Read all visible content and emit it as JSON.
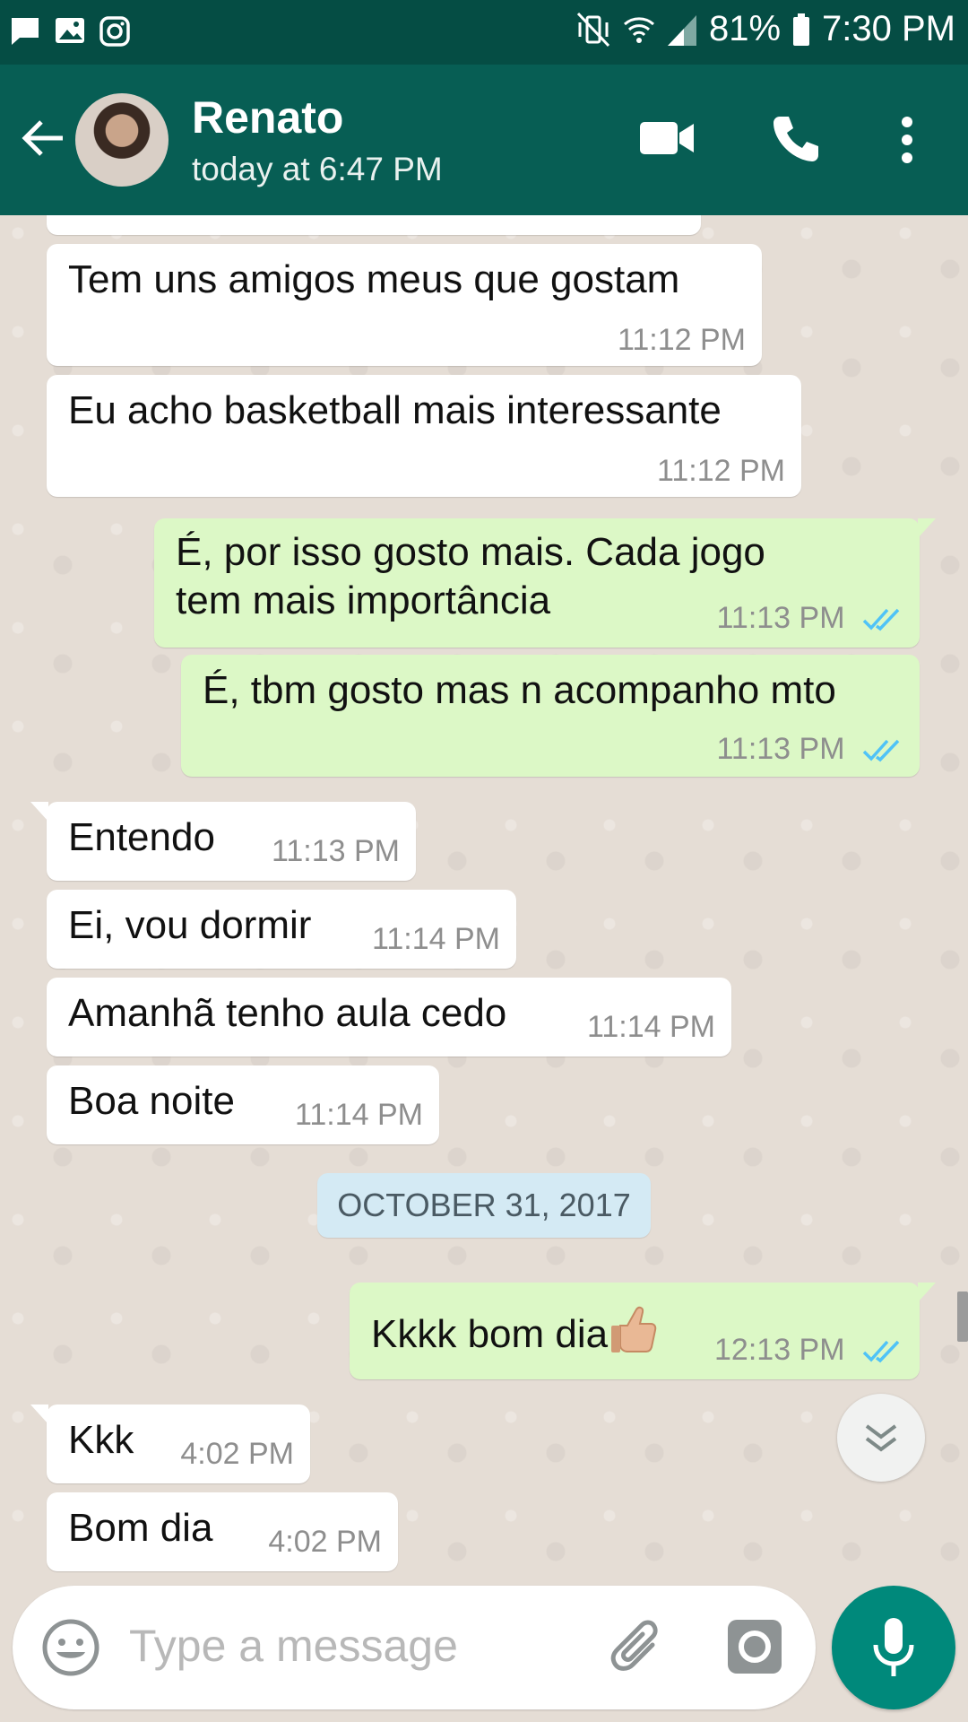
{
  "status_bar": {
    "battery": "81%",
    "time": "7:30 PM"
  },
  "header": {
    "contact_name": "Renato",
    "last_seen": "today at 6:47 PM"
  },
  "messages": [
    {
      "text": "Tem uns amigos meus que gostam",
      "time": "11:12 PM"
    },
    {
      "text": "Eu acho basketball mais interessante",
      "time": "11:12 PM"
    },
    {
      "text_line1": "É, por isso gosto mais. Cada jogo",
      "text_line2": "tem mais importância",
      "time": "11:13 PM"
    },
    {
      "text": "É, tbm gosto mas n acompanho mto",
      "time": "11:13 PM"
    },
    {
      "text": "Entendo",
      "time": "11:13 PM"
    },
    {
      "text": "Ei, vou dormir",
      "time": "11:14 PM"
    },
    {
      "text": "Amanhã tenho aula cedo",
      "time": "11:14 PM"
    },
    {
      "text": "Boa noite",
      "time": "11:14 PM"
    },
    {
      "text": "Kkkk bom dia",
      "time": "12:13 PM"
    },
    {
      "text": "Kkk",
      "time": "4:02 PM"
    },
    {
      "text": "Bom dia",
      "time": "4:02 PM"
    }
  ],
  "date_divider": "OCTOBER 31, 2017",
  "composer": {
    "placeholder": "Type a message"
  },
  "colors": {
    "header": "#075e54",
    "status_bar": "#054d44",
    "outgoing": "#dcf8c6",
    "incoming": "#ffffff",
    "read_ticks": "#4fc3f7",
    "mic_button": "#00897b"
  }
}
